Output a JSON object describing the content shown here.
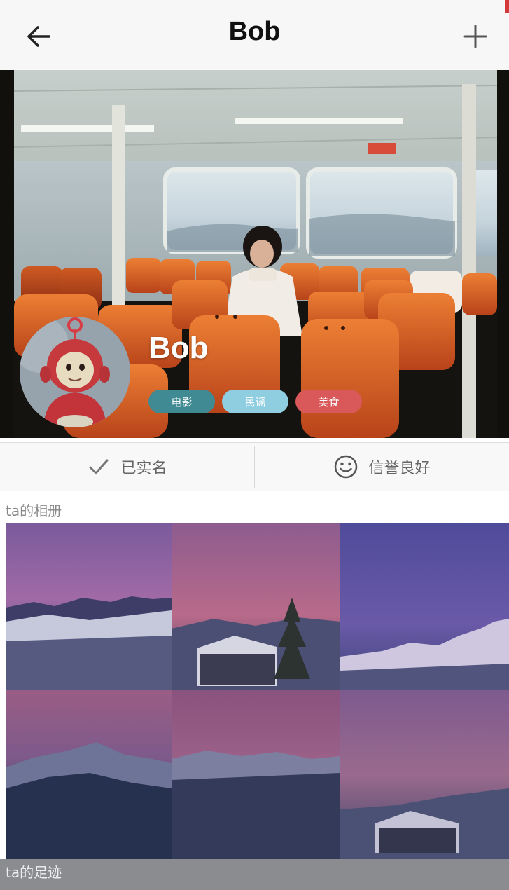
{
  "header": {
    "title": "Bob",
    "back_icon": "arrow-left-icon",
    "add_icon": "plus-icon"
  },
  "profile": {
    "name": "Bob",
    "tags": [
      {
        "label": "电影",
        "color": "#3f8a93"
      },
      {
        "label": "民谣",
        "color": "#8fcde0"
      },
      {
        "label": "美食",
        "color": "#d9595a"
      }
    ]
  },
  "verification": {
    "real_name": {
      "label": "已实名",
      "icon": "check-icon"
    },
    "credit": {
      "label": "信誉良好",
      "icon": "smiley-icon"
    }
  },
  "sections": {
    "album_title": "ta的相册",
    "footprint_title": "ta的足迹"
  },
  "colors": {
    "accent_teal": "#3f8a93",
    "accent_light_blue": "#8fcde0",
    "accent_red": "#d9595a"
  }
}
